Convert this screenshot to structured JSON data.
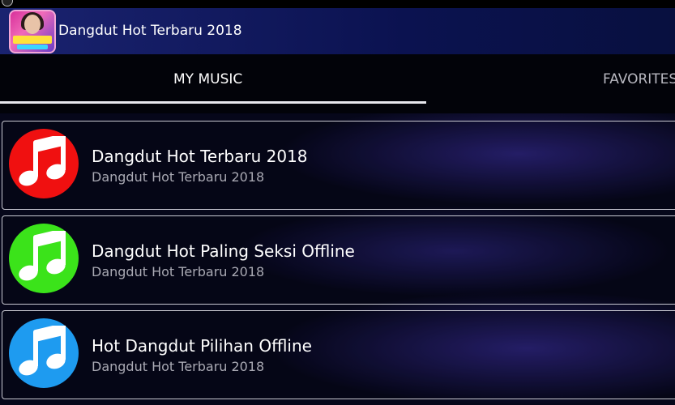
{
  "app_bar": {
    "title": "Dangdut Hot Terbaru 2018"
  },
  "tabs": [
    {
      "label": "MY MUSIC",
      "selected": true
    },
    {
      "label": "FAVORITES",
      "selected": false
    }
  ],
  "list": [
    {
      "title": "Dangdut Hot Terbaru 2018",
      "subtitle": "Dangdut Hot Terbaru 2018",
      "icon": "music-note-icon",
      "color": "#f01010"
    },
    {
      "title": "Dangdut Hot Paling Seksi Offline",
      "subtitle": "Dangdut Hot Terbaru 2018",
      "icon": "music-note-icon",
      "color": "#3be31a"
    },
    {
      "title": "Hot Dangdut Pilihan Offline",
      "subtitle": "Dangdut Hot Terbaru 2018",
      "icon": "music-note-icon",
      "color": "#1e9bf0"
    }
  ],
  "colors": {
    "app_bar": "#1a2370",
    "tab_bar": "#020309",
    "indicator": "#e8e8ee"
  }
}
